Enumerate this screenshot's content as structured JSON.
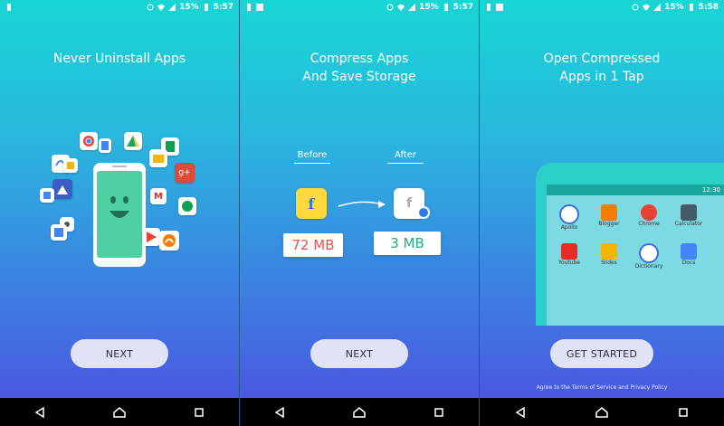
{
  "status": [
    {
      "battery": "15%",
      "time": "5:57"
    },
    {
      "battery": "15%",
      "time": "5:57"
    },
    {
      "battery": "15%",
      "time": "5:58"
    }
  ],
  "screen1": {
    "title": "Never Uninstall Apps",
    "button": "NEXT"
  },
  "screen2": {
    "title_line1": "Compress Apps",
    "title_line2": "And Save Storage",
    "before_label": "Before",
    "after_label": "After",
    "before_size": "72 MB",
    "after_size": "3 MB",
    "button": "NEXT"
  },
  "screen3": {
    "title_line1": "Open Compressed",
    "title_line2": "Apps in 1 Tap",
    "button": "GET STARTED",
    "terms": "Agree to the Terms of Service and Privacy Policy",
    "phone_time": "12:30",
    "apps": [
      {
        "name": "Apollo",
        "icon": "headphones-icon"
      },
      {
        "name": "Blogger",
        "icon": "blogger-icon"
      },
      {
        "name": "Chrome",
        "icon": "chrome-icon"
      },
      {
        "name": "Calculator",
        "icon": "calculator-icon"
      },
      {
        "name": "Youtube",
        "icon": "youtube-icon"
      },
      {
        "name": "Slides",
        "icon": "slides-icon"
      },
      {
        "name": "Dictionary",
        "icon": "dictionary-icon"
      },
      {
        "name": "Docs",
        "icon": "docs-icon"
      }
    ]
  },
  "colors": {
    "gradient_top": "#17d6d4",
    "gradient_bottom": "#4a58e0",
    "button_bg": "#dfe3f5",
    "button_text": "#2b2c4a",
    "red_size": "#e8524f",
    "green_size": "#1fb07e"
  }
}
